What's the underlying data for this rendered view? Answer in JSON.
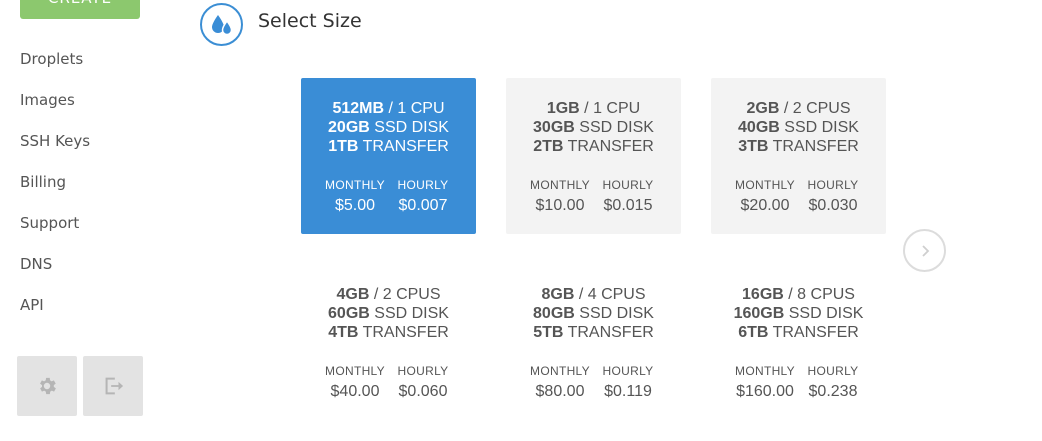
{
  "sidebar": {
    "create_label": "CREATE",
    "items": [
      {
        "label": "Droplets"
      },
      {
        "label": "Images"
      },
      {
        "label": "SSH Keys"
      },
      {
        "label": "Billing"
      },
      {
        "label": "Support"
      },
      {
        "label": "DNS"
      },
      {
        "label": "API"
      }
    ],
    "bottom_icons": [
      "gear-icon",
      "logout-icon"
    ]
  },
  "section": {
    "title": "Select Size",
    "icon": "droplets-icon",
    "accent_color": "#3a8dd6"
  },
  "sizes": [
    {
      "ram": "512MB",
      "cpu": "1 CPU",
      "disk": "20GB",
      "disk_label": "SSD DISK",
      "transfer": "1TB",
      "transfer_label": "TRANSFER",
      "monthly_label": "MONTHLY",
      "monthly": "$5.00",
      "hourly_label": "HOURLY",
      "hourly": "$0.007",
      "selected": true
    },
    {
      "ram": "1GB",
      "cpu": "1 CPU",
      "disk": "30GB",
      "disk_label": "SSD DISK",
      "transfer": "2TB",
      "transfer_label": "TRANSFER",
      "monthly_label": "MONTHLY",
      "monthly": "$10.00",
      "hourly_label": "HOURLY",
      "hourly": "$0.015",
      "selected": false
    },
    {
      "ram": "2GB",
      "cpu": "2 CPUS",
      "disk": "40GB",
      "disk_label": "SSD DISK",
      "transfer": "3TB",
      "transfer_label": "TRANSFER",
      "monthly_label": "MONTHLY",
      "monthly": "$20.00",
      "hourly_label": "HOURLY",
      "hourly": "$0.030",
      "selected": false
    },
    {
      "ram": "4GB",
      "cpu": "2 CPUS",
      "disk": "60GB",
      "disk_label": "SSD DISK",
      "transfer": "4TB",
      "transfer_label": "TRANSFER",
      "monthly_label": "MONTHLY",
      "monthly": "$40.00",
      "hourly_label": "HOURLY",
      "hourly": "$0.060",
      "selected": false
    },
    {
      "ram": "8GB",
      "cpu": "4 CPUS",
      "disk": "80GB",
      "disk_label": "SSD DISK",
      "transfer": "5TB",
      "transfer_label": "TRANSFER",
      "monthly_label": "MONTHLY",
      "monthly": "$80.00",
      "hourly_label": "HOURLY",
      "hourly": "$0.119",
      "selected": false
    },
    {
      "ram": "16GB",
      "cpu": "8 CPUS",
      "disk": "160GB",
      "disk_label": "SSD DISK",
      "transfer": "6TB",
      "transfer_label": "TRANSFER",
      "monthly_label": "MONTHLY",
      "monthly": "$160.00",
      "hourly_label": "HOURLY",
      "hourly": "$0.238",
      "selected": false
    }
  ],
  "carousel": {
    "next_icon": "chevron-right-icon"
  }
}
